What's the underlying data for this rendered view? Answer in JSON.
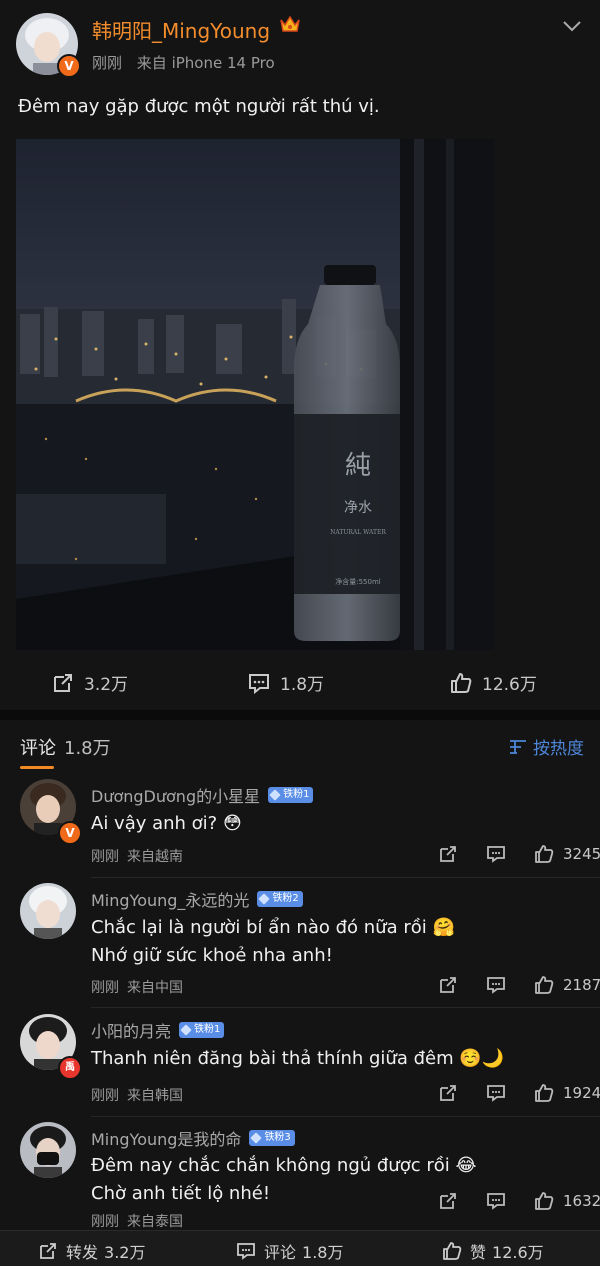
{
  "post": {
    "author": "韩明阳_MingYoung",
    "time": "刚刚",
    "source": "来自 iPhone 14 Pro",
    "text": "Đêm nay gặp được một người rất thú vị.",
    "bottle_brand": "純",
    "bottle_sub": "净水",
    "bottle_label": "NATURAL WATER",
    "bottle_volume": "净含量:550ml",
    "reposts": "3.2万",
    "comments": "1.8万",
    "likes": "12.6万"
  },
  "comments_header": {
    "title": "评论",
    "count": "1.8万",
    "sort_label": "按热度"
  },
  "comments": [
    {
      "name": "DươngDương的小星星",
      "badge": "铁粉1",
      "lines": [
        "Ai vậy anh ơi? 😳"
      ],
      "time": "刚刚",
      "location": "来自越南",
      "likes": "3245",
      "badge_v": "V"
    },
    {
      "name": "MingYoung_永远的光",
      "badge": "铁粉2",
      "lines": [
        "Chắc lại là người bí ẩn nào đó nữa rồi 🤗",
        "Nhớ giữ sức khoẻ nha anh!"
      ],
      "time": "刚刚",
      "location": "来自中国",
      "likes": "2187"
    },
    {
      "name": "小阳的月亮",
      "badge": "铁粉1",
      "lines": [
        "Thanh niên đăng bài thả thính giữa đêm ☺️🌙"
      ],
      "time": "刚刚",
      "location": "来自韩国",
      "likes": "1924",
      "badge_v": "禹"
    },
    {
      "name": "MingYoung是我的命",
      "badge": "铁粉3",
      "lines": [
        "Đêm nay chắc chắn không ngủ được rồi 😂",
        "Chờ anh tiết lộ nhé!"
      ],
      "time": "刚刚",
      "location": "来自泰国",
      "likes": "1632"
    }
  ],
  "bottom_bar": {
    "repost_label": "转发",
    "repost_count": "3.2万",
    "comment_label": "评论",
    "comment_count": "1.8万",
    "like_label": "赞",
    "like_count": "12.6万"
  },
  "icons": {
    "verified": "verified-badge-icon",
    "crown": "crown-icon",
    "chevron": "chevron-down-icon",
    "repost": "repost-icon",
    "comment": "comment-icon",
    "like": "thumbs-up-icon",
    "sort": "sort-lines-icon"
  },
  "colors": {
    "background": "#141414",
    "author_name": "#f28c2c",
    "accent_blue": "#4e86d8",
    "fan_badge": "#5a8ee6",
    "verified": "#f06a1a"
  }
}
